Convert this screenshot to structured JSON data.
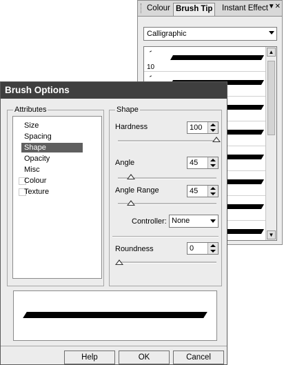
{
  "brush_tip_panel": {
    "tabs": [
      "Colour",
      "Brush Tip",
      "Instant Effect"
    ],
    "active_tab": "Brush Tip",
    "preset_dropdown": "Calligraphic",
    "first_tip_size": "10"
  },
  "dialog": {
    "title": "Brush Options",
    "attributes_label": "Attributes",
    "attributes": [
      "Size",
      "Spacing",
      "Shape",
      "Opacity",
      "Misc",
      "Colour",
      "Texture"
    ],
    "selected_attribute": "Shape",
    "shape_label": "Shape",
    "hardness": {
      "label": "Hardness",
      "value": "100",
      "slider_fraction": 1.0
    },
    "angle": {
      "label": "Angle",
      "value": "45",
      "slider_fraction": 0.0
    },
    "angle_range": {
      "label": "Angle Range",
      "value": "45",
      "slider_fraction": 0.0
    },
    "controller": {
      "label": "Controller:",
      "value": "None"
    },
    "roundness": {
      "label": "Roundness",
      "value": "0",
      "slider_fraction": 0.0
    },
    "buttons": {
      "help": "Help",
      "ok": "OK",
      "cancel": "Cancel"
    }
  },
  "colors": {
    "title_bar": "#3f3f3f",
    "selection": "#5f5f5f",
    "window_bg": "#ececec"
  }
}
